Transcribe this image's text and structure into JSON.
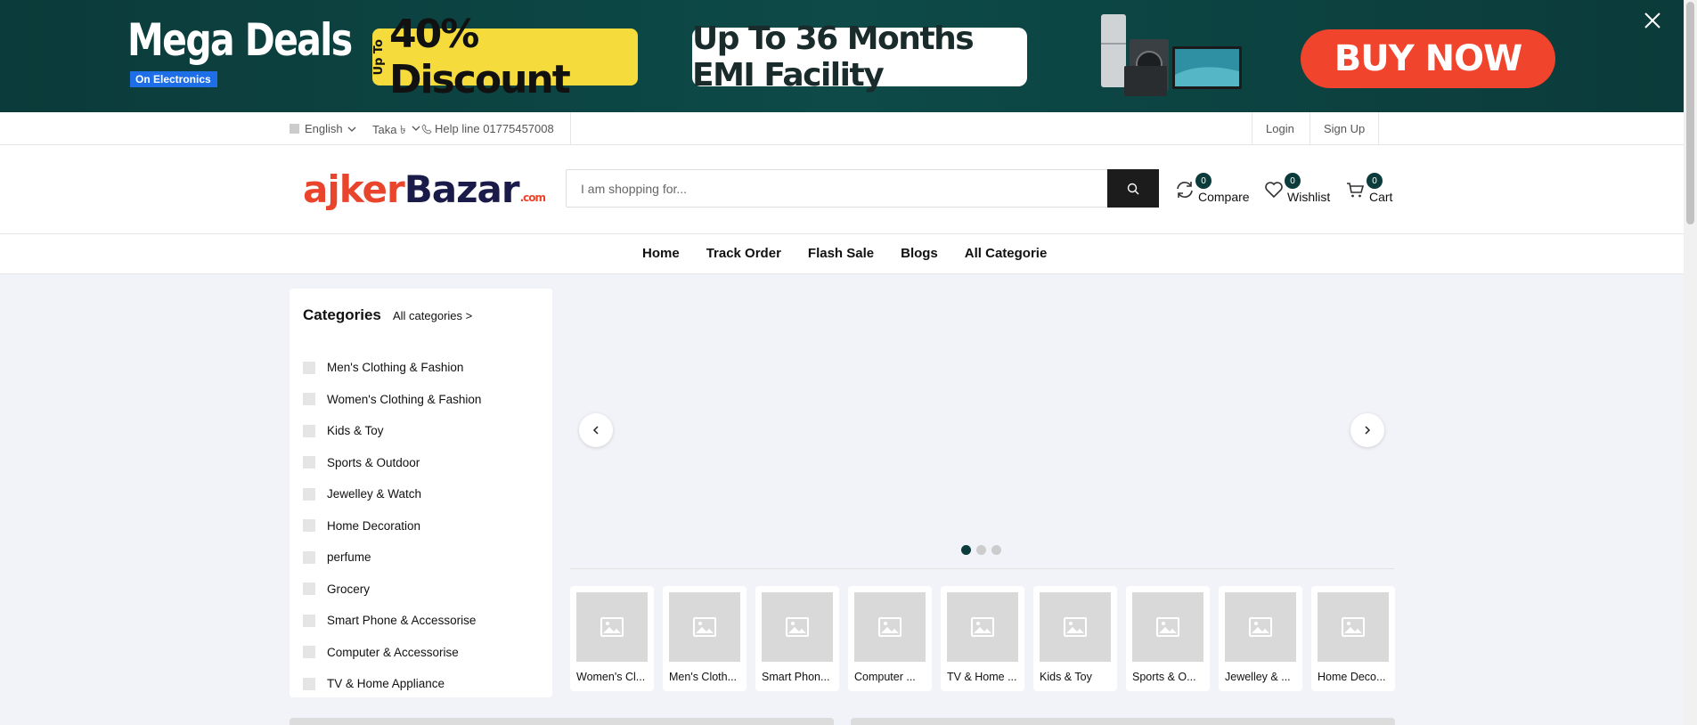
{
  "promo": {
    "mega_title": "Mega Deals",
    "mega_sub": "On Electronics",
    "upto": "Up To",
    "discount": "40% Discount",
    "emi": "Up To 36 Months EMI Facility",
    "buy_now": "BUY NOW"
  },
  "topbar": {
    "language": "English",
    "currency": "Taka ৳",
    "helpline": "Help line 01775457008",
    "login": "Login",
    "signup": "Sign Up"
  },
  "header": {
    "logo_part1": "ajker",
    "logo_part2": "Bazar",
    "logo_tld": ".com",
    "search_placeholder": "I am shopping for...",
    "compare_label": "Compare",
    "compare_count": "0",
    "wishlist_label": "Wishlist",
    "wishlist_count": "0",
    "cart_label": "Cart",
    "cart_count": "0"
  },
  "nav": {
    "items": [
      "Home",
      "Track Order",
      "Flash Sale",
      "Blogs",
      "All Categorie"
    ]
  },
  "categories": {
    "title": "Categories",
    "all_link": "All categories >",
    "items": [
      "Men's Clothing & Fashion",
      "Women's Clothing & Fashion",
      "Kids & Toy",
      "Sports & Outdoor",
      "Jewelley & Watch",
      "Home Decoration",
      "perfume",
      "Grocery",
      "Smart Phone & Accessorise",
      "Computer & Accessorise",
      "TV & Home Appliance"
    ]
  },
  "slider": {
    "prev_icon": "chevron-left-icon",
    "next_icon": "chevron-right-icon",
    "dot_count": 3,
    "active_dot": 0
  },
  "tiles": [
    "Women's Cl...",
    "Men's Cloth...",
    "Smart Phon...",
    "Computer ...",
    "TV & Home ...",
    "Kids & Toy",
    "Sports & O...",
    "Jewelley & ...",
    "Home Deco..."
  ],
  "colors": {
    "brand_dark": "#0b3b3a",
    "brand_orange": "#e8452c",
    "buy_button": "#f0442d",
    "discount_yellow": "#f5dc3c"
  }
}
